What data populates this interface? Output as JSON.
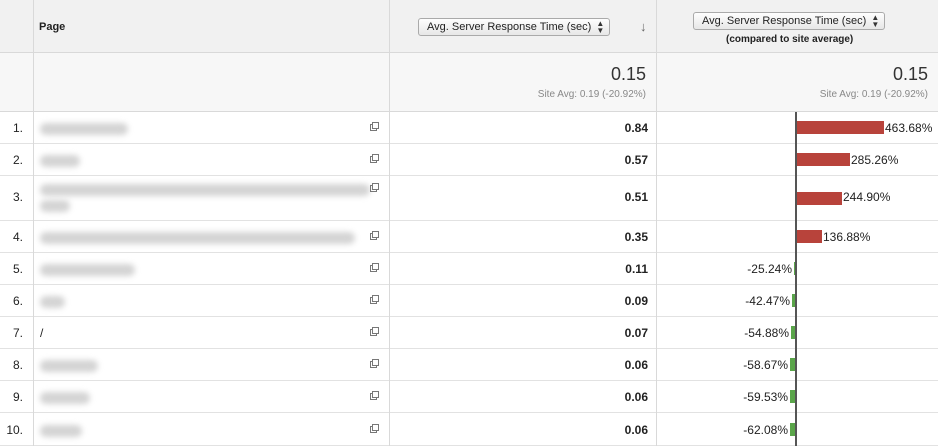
{
  "header": {
    "page_label": "Page",
    "metric_select": "Avg. Server Response Time (sec)",
    "compare_select": "Avg. Server Response Time (sec)",
    "compare_sub": "(compared to site average)"
  },
  "summary": {
    "metric_value": "0.15",
    "metric_avg": "Site Avg: 0.19 (-20.92%)",
    "compare_value": "0.15",
    "compare_avg": "Site Avg: 0.19 (-20.92%)"
  },
  "colors": {
    "positive": "#b8433b",
    "negative": "#5aa54a"
  },
  "rows": [
    {
      "index": "1.",
      "page": "",
      "value": "0.84",
      "pct_label": "463.68%",
      "pct": 463.68
    },
    {
      "index": "2.",
      "page": "",
      "value": "0.57",
      "pct_label": "285.26%",
      "pct": 285.26
    },
    {
      "index": "3.",
      "page": "",
      "value": "0.51",
      "pct_label": "244.90%",
      "pct": 244.9
    },
    {
      "index": "4.",
      "page": "",
      "value": "0.35",
      "pct_label": "136.88%",
      "pct": 136.88
    },
    {
      "index": "5.",
      "page": "",
      "value": "0.11",
      "pct_label": "-25.24%",
      "pct": -25.24
    },
    {
      "index": "6.",
      "page": "",
      "value": "0.09",
      "pct_label": "-42.47%",
      "pct": -42.47
    },
    {
      "index": "7.",
      "page": "/",
      "value": "0.07",
      "pct_label": "-54.88%",
      "pct": -54.88
    },
    {
      "index": "8.",
      "page": "",
      "value": "0.06",
      "pct_label": "-58.67%",
      "pct": -58.67
    },
    {
      "index": "9.",
      "page": "",
      "value": "0.06",
      "pct_label": "-59.53%",
      "pct": -59.53
    },
    {
      "index": "10.",
      "page": "",
      "value": "0.06",
      "pct_label": "-62.08%",
      "pct": -62.08
    }
  ]
}
